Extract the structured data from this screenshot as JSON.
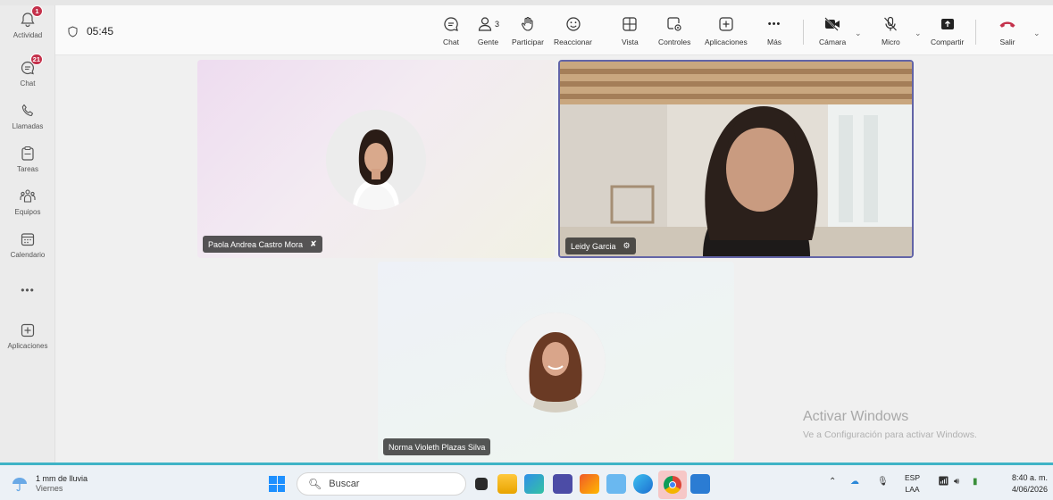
{
  "rail": {
    "items": [
      {
        "label": "Actividad",
        "badge": "1"
      },
      {
        "label": "Chat",
        "badge": "21"
      },
      {
        "label": "Llamadas"
      },
      {
        "label": "Tareas"
      },
      {
        "label": "Equipos"
      },
      {
        "label": "Calendario"
      },
      {
        "label": "Aplicaciones"
      }
    ],
    "more": "•••"
  },
  "header": {
    "timer": "05:45",
    "toolbar": {
      "chat": "Chat",
      "people": "Gente",
      "people_count": "3",
      "raise": "Participar",
      "react": "Reaccionar",
      "view": "Vista",
      "controls": "Controles",
      "apps": "Aplicaciones",
      "more": "Más",
      "more_glyph": "•••",
      "camera": "Cámara",
      "mic": "Micro",
      "share": "Compartir",
      "leave": "Salir"
    }
  },
  "participants": [
    {
      "name": "Paola Andrea Castro Mora",
      "muted": true
    },
    {
      "name": "Leidy Garcia",
      "sharing": true
    },
    {
      "name": "Norma Violeth Plazas Silva"
    }
  ],
  "watermark": {
    "title": "Activar Windows",
    "subtitle": "Ve a Configuración para activar Windows."
  },
  "taskbar": {
    "weather_line1": "1 mm de lluvia",
    "weather_line2": "Viernes",
    "search_placeholder": "Buscar",
    "lang1": "ESP",
    "lang2": "LAA",
    "time": "8:40 a. m.",
    "date": "4/06/2026"
  },
  "colors": {
    "accent": "#6264a7",
    "badge": "#c4314b",
    "leave": "#c4314b",
    "taskbar_border": "#3fb3c6"
  }
}
